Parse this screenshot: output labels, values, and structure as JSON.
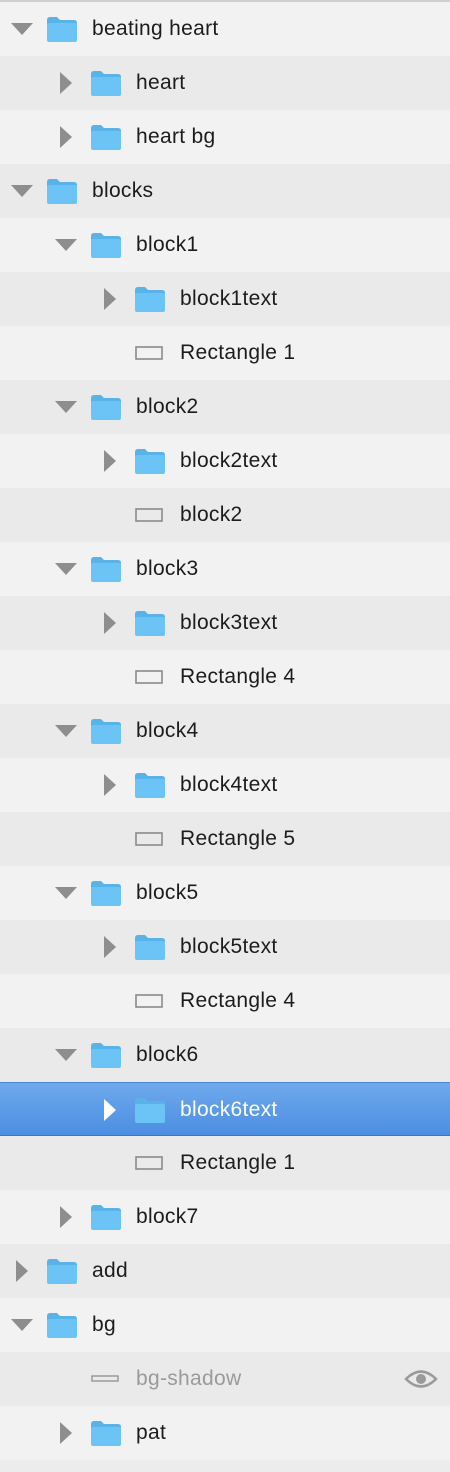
{
  "layers": [
    {
      "label": "beating heart",
      "depth": 0,
      "kind": "folder",
      "disclosure": "expanded"
    },
    {
      "label": "heart",
      "depth": 1,
      "kind": "folder",
      "disclosure": "collapsed"
    },
    {
      "label": "heart bg",
      "depth": 1,
      "kind": "folder",
      "disclosure": "collapsed"
    },
    {
      "label": "blocks",
      "depth": 0,
      "kind": "folder",
      "disclosure": "expanded"
    },
    {
      "label": "block1",
      "depth": 1,
      "kind": "folder",
      "disclosure": "expanded"
    },
    {
      "label": "block1text",
      "depth": 2,
      "kind": "folder",
      "disclosure": "collapsed"
    },
    {
      "label": "Rectangle 1",
      "depth": 2,
      "kind": "rectangle",
      "disclosure": "none"
    },
    {
      "label": "block2",
      "depth": 1,
      "kind": "folder",
      "disclosure": "expanded"
    },
    {
      "label": "block2text",
      "depth": 2,
      "kind": "folder",
      "disclosure": "collapsed"
    },
    {
      "label": "block2",
      "depth": 2,
      "kind": "rectangle",
      "disclosure": "none"
    },
    {
      "label": "block3",
      "depth": 1,
      "kind": "folder",
      "disclosure": "expanded"
    },
    {
      "label": "block3text",
      "depth": 2,
      "kind": "folder",
      "disclosure": "collapsed"
    },
    {
      "label": "Rectangle 4",
      "depth": 2,
      "kind": "rectangle",
      "disclosure": "none"
    },
    {
      "label": "block4",
      "depth": 1,
      "kind": "folder",
      "disclosure": "expanded"
    },
    {
      "label": "block4text",
      "depth": 2,
      "kind": "folder",
      "disclosure": "collapsed"
    },
    {
      "label": "Rectangle 5",
      "depth": 2,
      "kind": "rectangle",
      "disclosure": "none"
    },
    {
      "label": "block5",
      "depth": 1,
      "kind": "folder",
      "disclosure": "expanded"
    },
    {
      "label": "block5text",
      "depth": 2,
      "kind": "folder",
      "disclosure": "collapsed"
    },
    {
      "label": "Rectangle 4",
      "depth": 2,
      "kind": "rectangle",
      "disclosure": "none"
    },
    {
      "label": "block6",
      "depth": 1,
      "kind": "folder",
      "disclosure": "expanded"
    },
    {
      "label": "block6text",
      "depth": 2,
      "kind": "folder",
      "disclosure": "collapsed",
      "selected": true
    },
    {
      "label": "Rectangle 1",
      "depth": 2,
      "kind": "rectangle",
      "disclosure": "none"
    },
    {
      "label": "block7",
      "depth": 1,
      "kind": "folder",
      "disclosure": "collapsed"
    },
    {
      "label": "add",
      "depth": 0,
      "kind": "folder",
      "disclosure": "collapsed"
    },
    {
      "label": "bg",
      "depth": 0,
      "kind": "folder",
      "disclosure": "expanded"
    },
    {
      "label": "bg-shadow",
      "depth": 1,
      "kind": "line",
      "disclosure": "none",
      "hidden": true,
      "status_icon": "eye-icon"
    },
    {
      "label": "pat",
      "depth": 1,
      "kind": "folder",
      "disclosure": "collapsed"
    }
  ],
  "colors": {
    "folder": "#6cc3f5",
    "folder_tab": "#5ab3e8",
    "selection": "#4b8ee2",
    "disclosure": "#8e8e8e"
  }
}
